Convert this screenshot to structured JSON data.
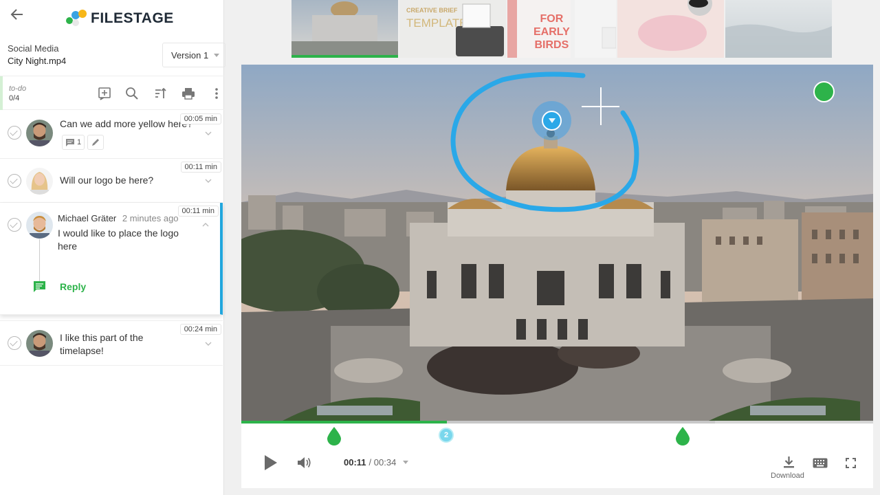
{
  "app": {
    "name": "FILESTAGE"
  },
  "file": {
    "folder": "Social Media",
    "name": "City Night.mp4"
  },
  "version": {
    "selected": "Version 1"
  },
  "todo": {
    "label": "to-do",
    "count": "0/4"
  },
  "toolbar_icons": [
    "add-comment-icon",
    "search-icon",
    "sort-icon",
    "print-icon",
    "more-vertical-icon"
  ],
  "comments": [
    {
      "text": "Can we add more yellow here?",
      "time": "00:05 min",
      "replies": "1",
      "resolved": false
    },
    {
      "text": "Will our logo be here?",
      "time": "00:11 min",
      "resolved": false
    },
    {
      "author": "Michael Gräter",
      "ago": "2 minutes ago",
      "text_line1": "I would like to place the logo",
      "text_line2": "here",
      "time": "00:11 min",
      "reply_label": "Reply",
      "resolved": false
    },
    {
      "text_line1": "I like this part of the",
      "text_line2": "timelapse!",
      "time": "00:24 min",
      "resolved": false
    }
  ],
  "filmstrip": [
    {
      "name": "palace-thumb"
    },
    {
      "line1": "CREATIVE BRIEF",
      "line2": "TEMPLATE"
    },
    {
      "line1": "FOR",
      "line2": "EARLY",
      "line3": "BIRDS"
    },
    {
      "name": "desk-thumb"
    },
    {
      "name": "dog-thumb"
    },
    {
      "name": "water-thumb"
    }
  ],
  "player": {
    "current_time": "00:11",
    "duration": "/ 00:34",
    "progress": 0.325,
    "marker_badge": "2",
    "download_label": "Download"
  },
  "colors": {
    "accent_green": "#2db34a",
    "annotation_blue": "#2aa8e8",
    "active_border": "#22a6dd"
  }
}
